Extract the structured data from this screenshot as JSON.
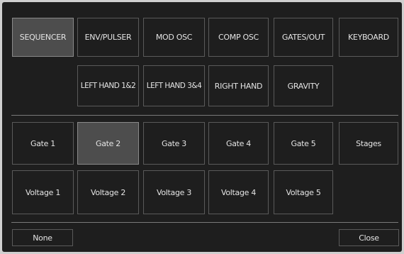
{
  "top_tabs": {
    "row1": [
      "SEQUENCER",
      "ENV/PULSER",
      "MOD OSC",
      "COMP OSC",
      "GATES/OUT",
      "KEYBOARD"
    ],
    "row2": [
      "LEFT HAND 1&2",
      "LEFT HAND 3&4",
      "RIGHT HAND",
      "GRAVITY"
    ],
    "selected": "SEQUENCER"
  },
  "options": {
    "row1": [
      "Gate 1",
      "Gate 2",
      "Gate 3",
      "Gate 4",
      "Gate 5",
      "Stages"
    ],
    "row2": [
      "Voltage 1",
      "Voltage 2",
      "Voltage 3",
      "Voltage 4",
      "Voltage 5"
    ],
    "selected": "Gate 2"
  },
  "footer": {
    "none_label": "None",
    "close_label": "Close"
  },
  "colors": {
    "panel_bg": "#1e1e1e",
    "border": "#5a5a5a",
    "selected_bg": "#4d4d4d",
    "text": "#e4e4e4"
  }
}
